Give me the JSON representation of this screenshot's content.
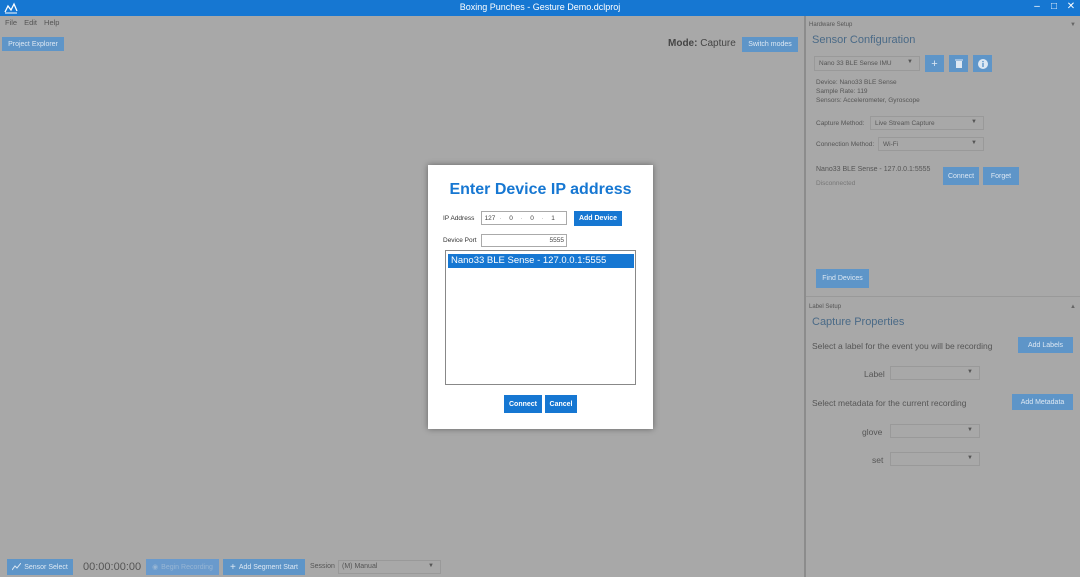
{
  "window": {
    "title": "Boxing Punches - Gesture Demo.dclproj",
    "minimize": "–",
    "maximize": "□",
    "close": "✕"
  },
  "menu": [
    "File",
    "Edit",
    "Help"
  ],
  "toolbar": {
    "project_explorer": "Project Explorer",
    "mode_label": "Mode:",
    "mode_value": "Capture",
    "switch_modes": "Switch modes"
  },
  "bottombar": {
    "sensor_select": "Sensor Select",
    "timer": "00:00:00:00",
    "begin_recording": "Begin Recording",
    "add_segment_start": "Add Segment Start",
    "session_label": "Session",
    "session_value": "(M) Manual"
  },
  "hardware": {
    "section": "Hardware Setup",
    "title": "Sensor Configuration",
    "sensor_select_value": "Nano 33 BLE Sense IMU",
    "device": "Device: Nano33 BLE Sense",
    "sample_rate": "Sample Rate: 119",
    "sensors": "Sensors: Accelerometer, Gyroscope",
    "capture_method_label": "Capture Method:",
    "capture_method_value": "Live Stream Capture",
    "connection_method_label": "Connection Method:",
    "connection_method_value": "Wi-Fi",
    "device_entry": "Nano33 BLE Sense - 127.0.0.1:5555",
    "device_status": "Disconnected",
    "connect": "Connect",
    "forget": "Forget",
    "find_devices": "Find Devices"
  },
  "label_setup": {
    "section": "Label Setup",
    "title": "Capture Properties",
    "select_label_text": "Select a label for the event you will be recording",
    "add_labels": "Add Labels",
    "label_field": "Label",
    "select_metadata_text": "Select metadata for the current recording",
    "add_metadata": "Add Metadata",
    "glove_field": "glove",
    "set_field": "set"
  },
  "dialog": {
    "title": "Enter Device IP address",
    "ip_label": "IP Address",
    "ip": [
      "127",
      "0",
      "0",
      "1"
    ],
    "add_device": "Add Device",
    "port_label": "Device Port",
    "port": "5555",
    "devices": [
      "Nano33 BLE Sense - 127.0.0.1:5555"
    ],
    "connect": "Connect",
    "cancel": "Cancel"
  },
  "colors": {
    "accent": "#1677d2",
    "overlay_gray": "#a8a8a8"
  }
}
